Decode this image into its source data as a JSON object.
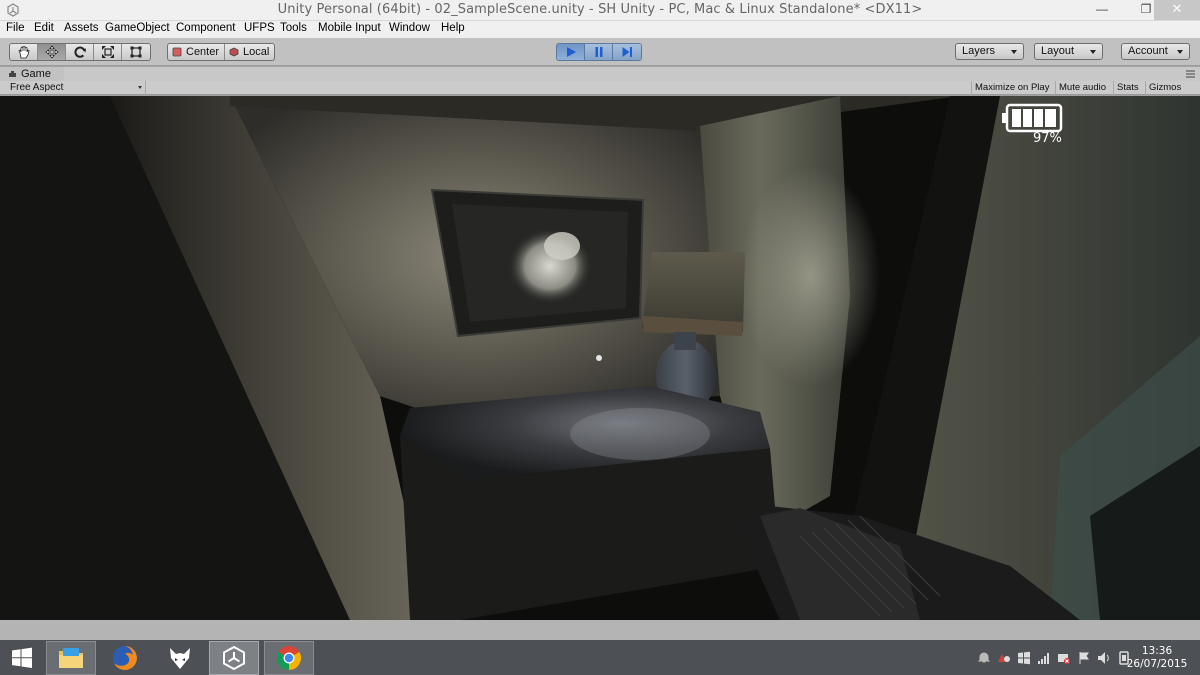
{
  "window": {
    "title": "Unity Personal (64bit) - 02_SampleScene.unity - SH Unity - PC, Mac & Linux Standalone* <DX11>",
    "minimize_glyph": "—",
    "restore_glyph": "❐",
    "close_glyph": "✕"
  },
  "menu": [
    "File",
    "Edit",
    "Assets",
    "GameObject",
    "Component",
    "UFPS",
    "Tools",
    "Mobile Input",
    "Window",
    "Help"
  ],
  "toolbar": {
    "transform_tools": [
      "hand-icon",
      "move-icon",
      "rotate-icon",
      "scale-icon",
      "rect-icon"
    ],
    "active_tool": "move-icon",
    "pivot_label": "Center",
    "space_label": "Local",
    "play_state": "playing",
    "layers_label": "Layers",
    "layout_label": "Layout",
    "account_label": "Account"
  },
  "game_view": {
    "tab_label": "Game",
    "aspect_label": "Free Aspect",
    "maximize_label": "Maximize on Play",
    "mute_label": "Mute audio",
    "stats_label": "Stats",
    "gizmos_label": "Gizmos",
    "battery_percent": "97%",
    "battery_level": 0.97
  },
  "taskbar": {
    "apps": [
      "file-explorer-icon",
      "firefox-icon",
      "foobar-icon",
      "unity-icon",
      "chrome-icon"
    ],
    "active_app": "unity-icon",
    "time": "13:36",
    "date": "26/07/2015"
  },
  "colors": {
    "accent_blue": "#2b6fd6",
    "taskbar": "#4d5054",
    "toolbar": "#c1c1c1"
  }
}
